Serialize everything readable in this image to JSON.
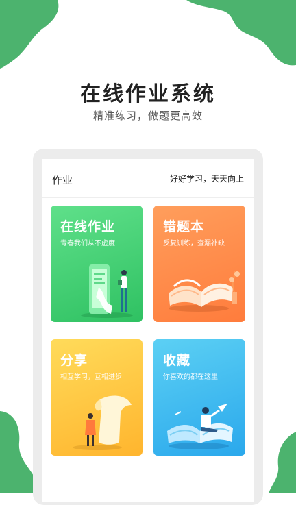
{
  "hero": {
    "title": "在线作业系统",
    "subtitle": "精准练习，做题更高效"
  },
  "app": {
    "header_title": "作业",
    "header_slogan": "好好学习，天天向上"
  },
  "cards": [
    {
      "title": "在线作业",
      "subtitle": "青春我们从不虚度",
      "color": "#3dcf72",
      "icon": "phone-reader-illustration"
    },
    {
      "title": "错题本",
      "subtitle": "反复训练，查漏补缺",
      "color": "#ff8a45",
      "icon": "open-book-illustration"
    },
    {
      "title": "分享",
      "subtitle": "相互学习，互相进步",
      "color": "#ffc23e",
      "icon": "scroll-illustration"
    },
    {
      "title": "收藏",
      "subtitle": "你喜欢的都在这里",
      "color": "#3ab8f0",
      "icon": "book-reader-illustration"
    }
  ],
  "colors": {
    "brand_green": "#4cb36e",
    "background": "#ffffff"
  }
}
